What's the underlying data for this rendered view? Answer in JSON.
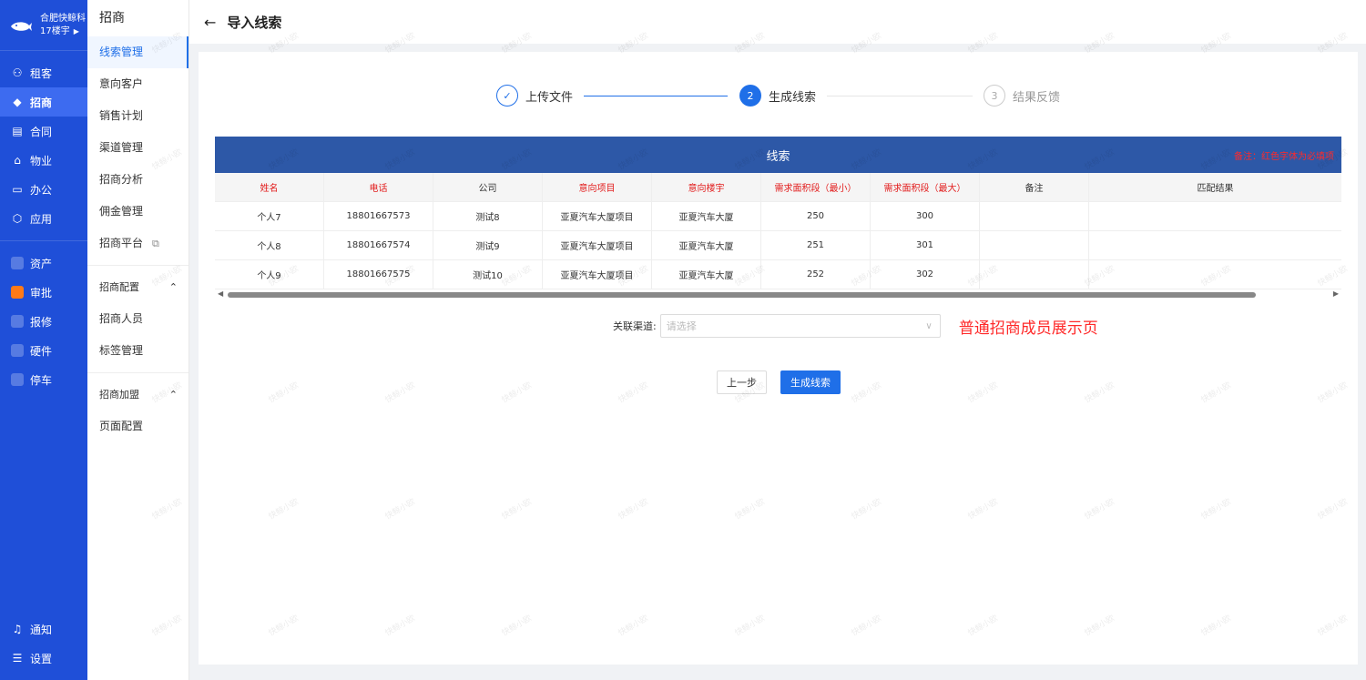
{
  "brand": {
    "name": "合肥快鲸科",
    "sub": "17楼宇"
  },
  "leftnav": {
    "main": [
      {
        "label": "租客",
        "icon": "user-group-icon"
      },
      {
        "label": "招商",
        "icon": "tag-icon",
        "active": true
      },
      {
        "label": "合同",
        "icon": "document-icon"
      },
      {
        "label": "物业",
        "icon": "home-icon"
      },
      {
        "label": "办公",
        "icon": "monitor-icon"
      },
      {
        "label": "应用",
        "icon": "apps-icon"
      }
    ],
    "apps": [
      {
        "label": "资产",
        "icon": "asset-icon"
      },
      {
        "label": "审批",
        "icon": "approval-icon"
      },
      {
        "label": "报修",
        "icon": "repair-icon"
      },
      {
        "label": "硬件",
        "icon": "hardware-icon"
      },
      {
        "label": "停车",
        "icon": "parking-icon"
      }
    ],
    "bottom": [
      {
        "label": "通知",
        "icon": "bell-icon"
      },
      {
        "label": "设置",
        "icon": "menu-icon"
      }
    ]
  },
  "subnav": {
    "title": "招商",
    "items": [
      "线索管理",
      "意向客户",
      "销售计划",
      "渠道管理",
      "招商分析",
      "佣金管理",
      "招商平台"
    ],
    "group1": "招商配置",
    "group1_items": [
      "招商人员",
      "标签管理"
    ],
    "group2": "招商加盟",
    "group2_items": [
      "页面配置"
    ]
  },
  "header": {
    "back": "←",
    "title": "导入线索"
  },
  "steps": [
    {
      "num": "✓",
      "label": "上传文件"
    },
    {
      "num": "2",
      "label": "生成线索"
    },
    {
      "num": "3",
      "label": "结果反馈"
    }
  ],
  "table": {
    "band_title": "线索",
    "band_note": "备注：红色字体为必填项",
    "headers": [
      "姓名",
      "电话",
      "公司",
      "意向项目",
      "意向楼宇",
      "需求面积段（最小）",
      "需求面积段（最大）",
      "备注",
      "匹配结果"
    ],
    "rows": [
      [
        "个人7",
        "18801667573",
        "测试8",
        "亚夏汽车大厦项目",
        "亚夏汽车大厦",
        "250",
        "300",
        "",
        ""
      ],
      [
        "个人8",
        "18801667574",
        "测试9",
        "亚夏汽车大厦项目",
        "亚夏汽车大厦",
        "251",
        "301",
        "",
        ""
      ],
      [
        "个人9",
        "18801667575",
        "测试10",
        "亚夏汽车大厦项目",
        "亚夏汽车大厦",
        "252",
        "302",
        "",
        ""
      ]
    ]
  },
  "form": {
    "label": "关联渠道:",
    "placeholder": "请选择",
    "red_tip": "普通招商成员展示页"
  },
  "buttons": {
    "prev": "上一步",
    "generate": "生成线索"
  },
  "watermark": "快鲸小欧",
  "colors": {
    "primary": "#1f6fe8",
    "nav": "#1f4fd8",
    "band": "#2d58a7",
    "required": "#e21c1c"
  }
}
